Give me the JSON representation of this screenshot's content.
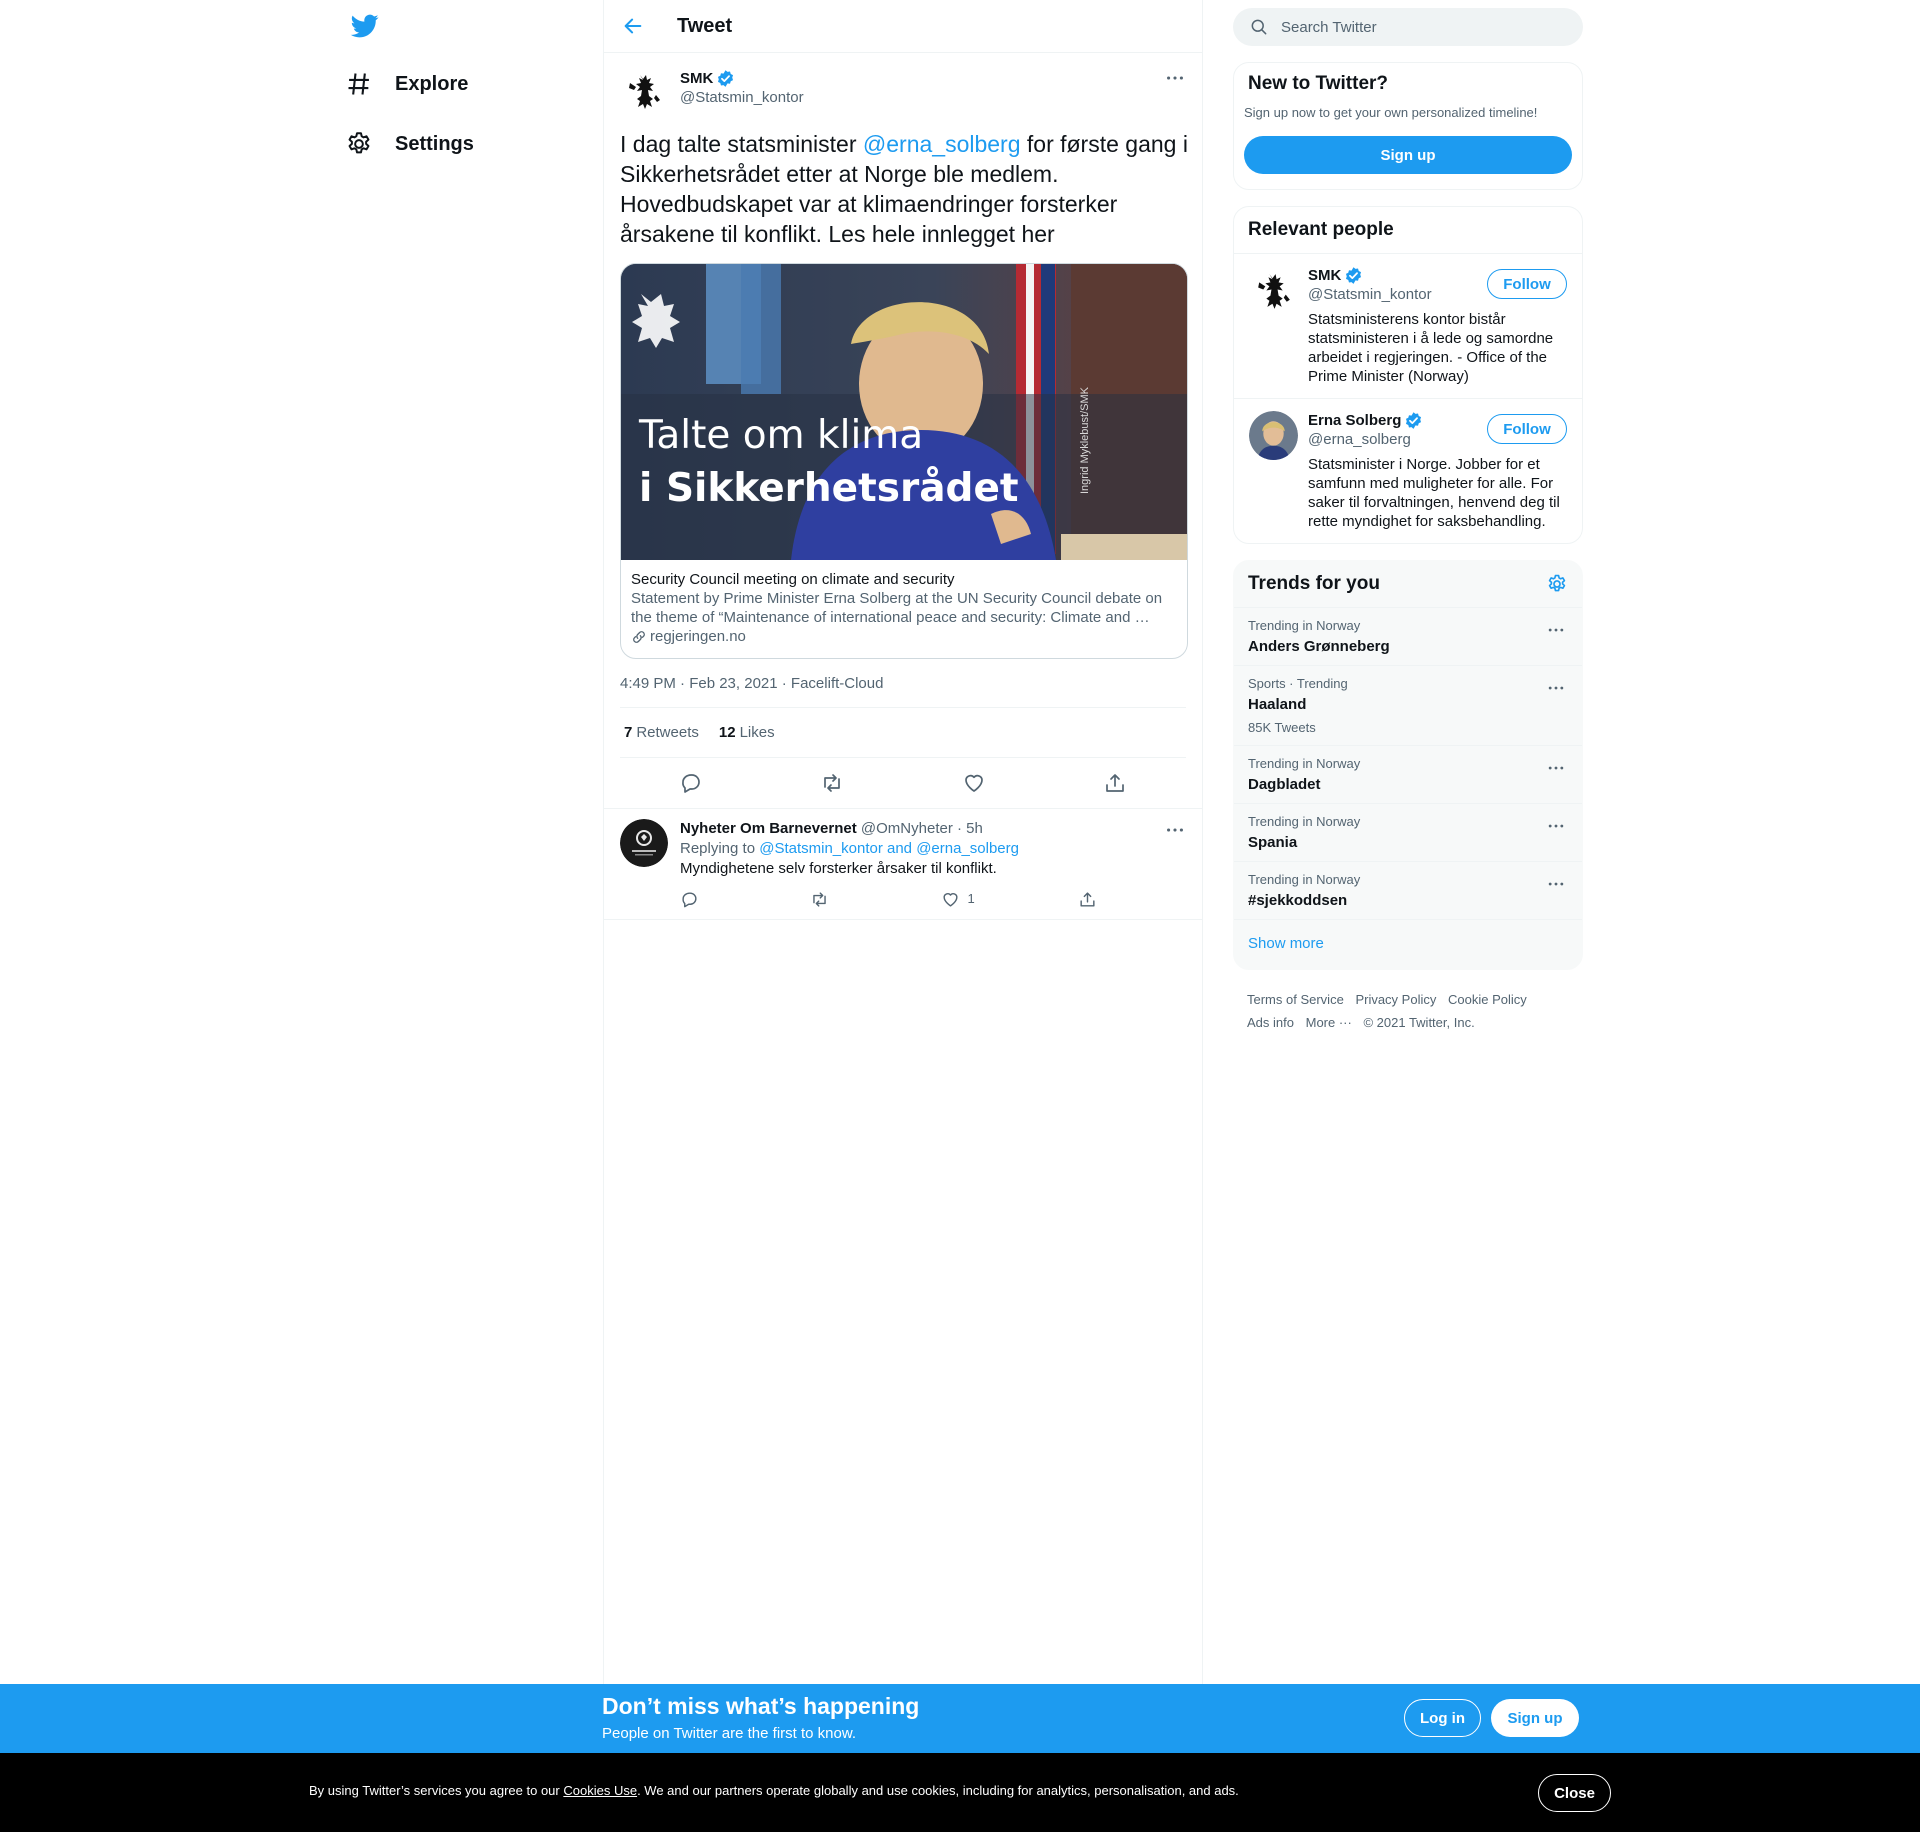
{
  "nav": {
    "items": [
      {
        "label": "Explore",
        "icon": "hashtag-icon"
      },
      {
        "label": "Settings",
        "icon": "gear-icon"
      }
    ]
  },
  "header": {
    "title": "Tweet"
  },
  "tweet": {
    "author": {
      "name": "SMK",
      "handle": "@Statsmin_kontor"
    },
    "text_before": "I dag talte statsminister ",
    "mention": "@erna_solberg",
    "text_after": " for første gang i Sikkerhetsrådet etter at Norge ble medlem. Hovedbudskapet var at klimaendringer forsterker årsakene til konflikt. Les hele innlegget her",
    "card": {
      "image_caption_line1": "Talte om klima",
      "image_caption_line2": "i Sikkerhetsrådet",
      "image_credit": "Ingrid Myklebust/SMK",
      "title": "Security Council meeting on climate and security",
      "description": "Statement by Prime Minister Erna Solberg at the UN Security Council debate on the theme of “Maintenance of international peace and security: Climate and …",
      "domain": "regjeringen.no"
    },
    "timestamp": "4:49 PM · Feb 23, 2021 · Facelift-Cloud",
    "retweets_count": "7",
    "retweets_label": "Retweets",
    "likes_count": "12",
    "likes_label": "Likes"
  },
  "reply": {
    "name": "Nyheter Om Barnevernet",
    "handle": "@OmNyheter",
    "time": "· 5h",
    "replying_label": "Replying to",
    "replying_to": "@Statsmin_kontor and @erna_solberg",
    "text": "Myndighetene selv forsterker årsaker til konflikt.",
    "like_count": "1"
  },
  "search": {
    "placeholder": "Search Twitter"
  },
  "new_to_twitter": {
    "title": "New to Twitter?",
    "subtitle": "Sign up now to get your own personalized timeline!",
    "signup": "Sign up"
  },
  "relevant_people": {
    "title": "Relevant people",
    "people": [
      {
        "name": "SMK",
        "handle": "@Statsmin_kontor",
        "follow": "Follow",
        "bio": "Statsministerens kontor bistår statsministeren i å lede og samordne arbeidet i regjeringen. - Office of the Prime Minister (Norway)"
      },
      {
        "name": "Erna Solberg",
        "handle": "@erna_solberg",
        "follow": "Follow",
        "bio": "Statsminister i Norge. Jobber for et samfunn med muligheter for alle. For saker til forvaltningen, henvend deg til rette myndighet for saksbehandling."
      }
    ]
  },
  "trends": {
    "title": "Trends for you",
    "items": [
      {
        "context": "Trending in Norway",
        "name": "Anders Grønneberg",
        "count": ""
      },
      {
        "context": "Sports · Trending",
        "name": "Haaland",
        "count": "85K Tweets"
      },
      {
        "context": "Trending in Norway",
        "name": "Dagbladet",
        "count": ""
      },
      {
        "context": "Trending in Norway",
        "name": "Spania",
        "count": ""
      },
      {
        "context": "Trending in Norway",
        "name": "#sjekkoddsen",
        "count": ""
      }
    ],
    "show_more": "Show more"
  },
  "footer": {
    "terms": "Terms of Service",
    "privacy": "Privacy Policy",
    "cookie": "Cookie Policy",
    "ads": "Ads info",
    "more": "More ···",
    "copyright": "© 2021 Twitter, Inc."
  },
  "bottom_bar": {
    "title": "Don’t miss what’s happening",
    "subtitle": "People on Twitter are the first to know.",
    "login": "Log in",
    "signup": "Sign up"
  },
  "cookie_bar": {
    "text_before": "By using Twitter’s services you agree to our ",
    "link": "Cookies Use",
    "text_after": ". We and our partners operate globally and use cookies, including for analytics, personalisation, and ads.",
    "close": "Close"
  },
  "colors": {
    "accent": "#1d9bf0",
    "text": "#0f1419",
    "muted": "#536471",
    "border": "#eff3f4"
  }
}
